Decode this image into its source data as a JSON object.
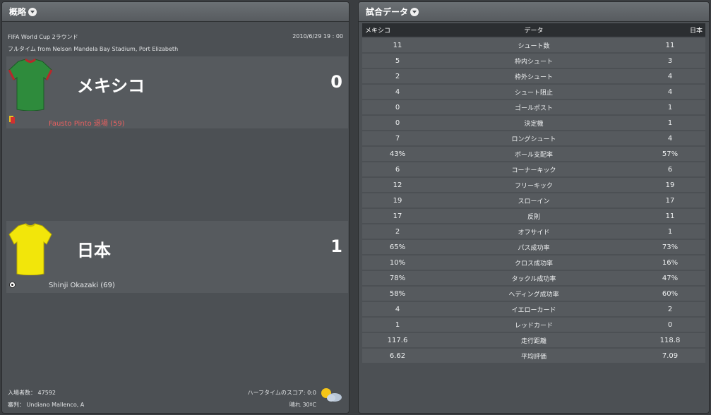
{
  "overview": {
    "title": "概略",
    "competition": "FIFA World Cup 2ラウンド",
    "datetime": "2010/6/29 19 : 00",
    "venue": "フルタイム from Nelson Mandela Bay Stadium, Port Elizabeth",
    "home": {
      "name": "メキシコ",
      "score": "0",
      "shirt_color": "#2e8b3c",
      "shirt_trim": "#b8282a",
      "event_icon": "card-icon",
      "event": "Fausto Pinto 退場 (59)",
      "event_color": "#e86060"
    },
    "away": {
      "name": "日本",
      "score": "1",
      "shirt_color": "#f2e60a",
      "shirt_trim": "#f2e60a",
      "event_icon": "ball-icon",
      "event": "Shinji Okazaki (69)",
      "event_color": "#e6e8ea"
    },
    "footer": {
      "attendance": "入場者数： 47592",
      "referee": "審判： Undiano Mallenco, A",
      "halftime": "ハーフタイムのスコア: 0:0",
      "weather": "晴れ 30ºC",
      "weather_icon": "sun-cloud-icon"
    }
  },
  "stats": {
    "title": "試合データ",
    "header_left": "メキシコ",
    "header_mid": "データ",
    "header_right": "日本",
    "rows": [
      {
        "left": "11",
        "label": "シュート数",
        "right": "11"
      },
      {
        "left": "5",
        "label": "枠内シュート",
        "right": "3"
      },
      {
        "left": "2",
        "label": "枠外シュート",
        "right": "4"
      },
      {
        "left": "4",
        "label": "シュート阻止",
        "right": "4"
      },
      {
        "left": "0",
        "label": "ゴールポスト",
        "right": "1"
      },
      {
        "left": "0",
        "label": "決定機",
        "right": "1"
      },
      {
        "left": "7",
        "label": "ロングシュート",
        "right": "4"
      },
      {
        "left": "43%",
        "label": "ボール支配率",
        "right": "57%"
      },
      {
        "left": "6",
        "label": "コーナーキック",
        "right": "6"
      },
      {
        "left": "12",
        "label": "フリーキック",
        "right": "19"
      },
      {
        "left": "19",
        "label": "スローイン",
        "right": "17"
      },
      {
        "left": "17",
        "label": "反則",
        "right": "11"
      },
      {
        "left": "2",
        "label": "オフサイド",
        "right": "1"
      },
      {
        "left": "65%",
        "label": "パス成功率",
        "right": "73%"
      },
      {
        "left": "10%",
        "label": "クロス成功率",
        "right": "16%"
      },
      {
        "left": "78%",
        "label": "タックル成功率",
        "right": "47%"
      },
      {
        "left": "58%",
        "label": "ヘディング成功率",
        "right": "60%"
      },
      {
        "left": "4",
        "label": "イエローカード",
        "right": "2"
      },
      {
        "left": "1",
        "label": "レッドカード",
        "right": "0"
      },
      {
        "left": "117.6",
        "label": "走行距離",
        "right": "118.8"
      },
      {
        "left": "6.62",
        "label": "平均評価",
        "right": "7.09"
      }
    ]
  }
}
